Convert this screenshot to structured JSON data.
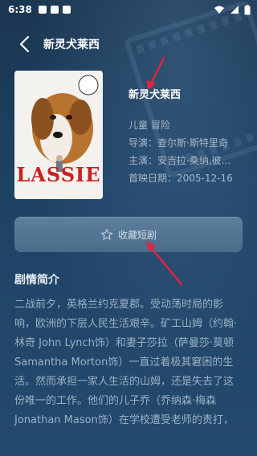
{
  "status_bar": {
    "time": "6:38"
  },
  "header": {
    "title": "新灵犬莱西"
  },
  "movie": {
    "title": "新灵犬莱西",
    "genre": "儿童 冒险",
    "director": "导演：查尔斯·斯特里奇",
    "cast": "主演：安吉拉·桑纳,彼...",
    "release_date": "首映日期：2005-12-16",
    "poster_title": "LASSIE"
  },
  "collect_button": {
    "label": "收藏短剧"
  },
  "synopsis": {
    "heading": "剧情简介",
    "text": "二战前夕，英格兰约克夏郡。受动荡时局的影响，欧洲的下层人民生活艰辛。矿工山姆（约翰·林奇 John Lynch饰）和妻子莎拉（萨曼莎·莫顿 Samantha Morton饰）一直过着极其窘困的生活。然而承担一家人生活的山姆，还是失去了这份唯一的工作。他们的儿子乔（乔纳森·梅森 Jonathan Mason饰）在学校遭受老师的责打，"
  },
  "colors": {
    "accent_arrow": "#e1253a",
    "button": "#587898"
  },
  "icons": [
    "back-arrow-icon",
    "star-outline-icon",
    "wifi-icon",
    "signal-icon",
    "battery-icon"
  ]
}
